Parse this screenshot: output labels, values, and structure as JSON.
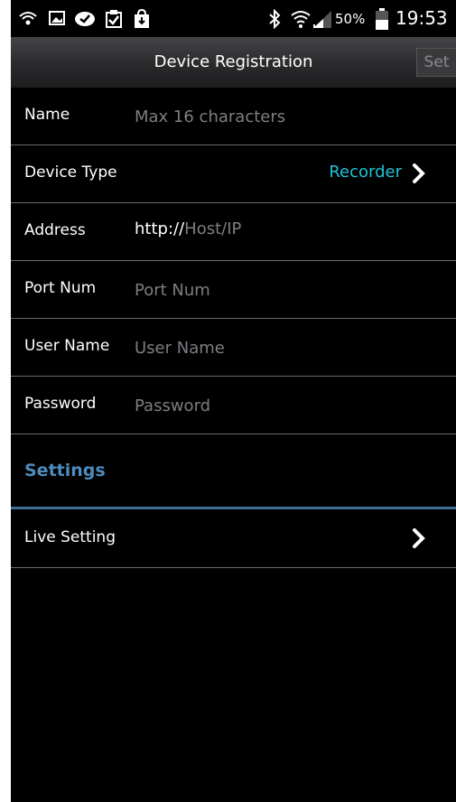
{
  "status_bar": {
    "battery_percent": "50%",
    "time": "19:53",
    "icons": [
      "wifi-call-icon",
      "image-icon",
      "checkmark-cloud-icon",
      "clipboard-check-icon",
      "shopping-bag-icon",
      "bluetooth-icon",
      "wifi-icon",
      "signal-icon",
      "battery-icon"
    ]
  },
  "title_bar": {
    "title": "Device Registration",
    "set_label": "Set"
  },
  "form": {
    "name": {
      "label": "Name",
      "placeholder": "Max 16 characters",
      "value": ""
    },
    "device_type": {
      "label": "Device Type",
      "value": "Recorder"
    },
    "address": {
      "label": "Address",
      "prefix": "http://",
      "placeholder": "Host/IP",
      "value": ""
    },
    "port": {
      "label": "Port Num",
      "placeholder": "Port Num",
      "value": ""
    },
    "user_name": {
      "label": "User Name",
      "placeholder": "User Name",
      "value": ""
    },
    "password": {
      "label": "Password",
      "placeholder": "Password",
      "value": ""
    }
  },
  "settings": {
    "title": "Settings",
    "live_setting_label": "Live Setting"
  },
  "colors": {
    "background": "#000000",
    "accent_value": "#1fc3d6",
    "section_title": "#4e8bbe",
    "section_divider": "#3c6d96",
    "placeholder": "#7c7e82"
  }
}
